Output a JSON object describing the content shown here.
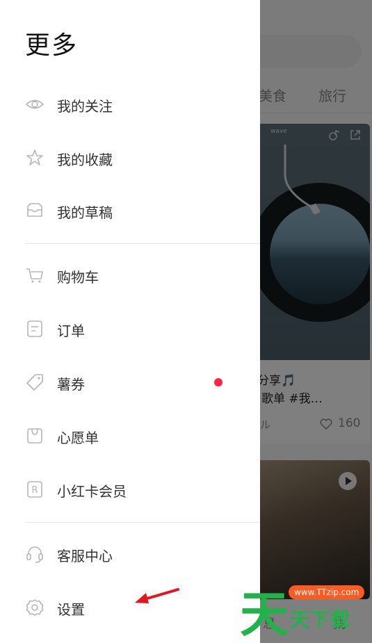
{
  "drawer": {
    "title": "更多",
    "items": [
      {
        "label": "我的关注",
        "icon": "eye-icon"
      },
      {
        "label": "我的收藏",
        "icon": "star-icon"
      },
      {
        "label": "我的草稿",
        "icon": "inbox-icon"
      },
      {
        "label": "购物车",
        "icon": "cart-icon"
      },
      {
        "label": "订单",
        "icon": "order-icon"
      },
      {
        "label": "薯券",
        "icon": "coupon-tag-icon"
      },
      {
        "label": "心愿单",
        "icon": "wishlist-bag-icon"
      },
      {
        "label": "小红卡会员",
        "icon": "r-card-icon"
      },
      {
        "label": "客服中心",
        "icon": "headset-icon"
      },
      {
        "label": "设置",
        "icon": "gear-icon"
      }
    ],
    "badge_color": "#ff2442"
  },
  "background": {
    "tabs": [
      "美食",
      "旅行"
    ],
    "card1": {
      "brand": "wave",
      "title_line1": "分享🎵",
      "title_line2": "歌单 #我…",
      "user": "ル",
      "likes": "160"
    },
    "bottom_nav": [
      "息",
      "我"
    ]
  },
  "watermark": {
    "url": "www.TTzip.com",
    "big": "天",
    "sub": "天下载"
  }
}
